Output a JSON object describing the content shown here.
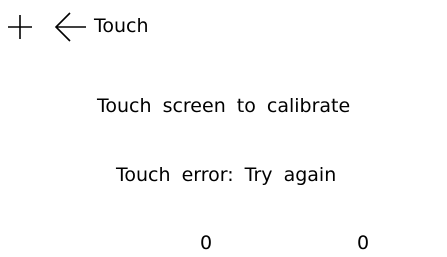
{
  "header": {
    "crosshair_icon": "crosshair-plus-icon",
    "back_icon": "arrow-left-icon",
    "title": "Touch"
  },
  "main": {
    "instruction": "Touch screen to calibrate",
    "error_message": "Touch error: Try again",
    "coordinates": {
      "x": "0",
      "y": "0"
    }
  },
  "colors": {
    "background": "#ffffff",
    "foreground": "#000000"
  }
}
